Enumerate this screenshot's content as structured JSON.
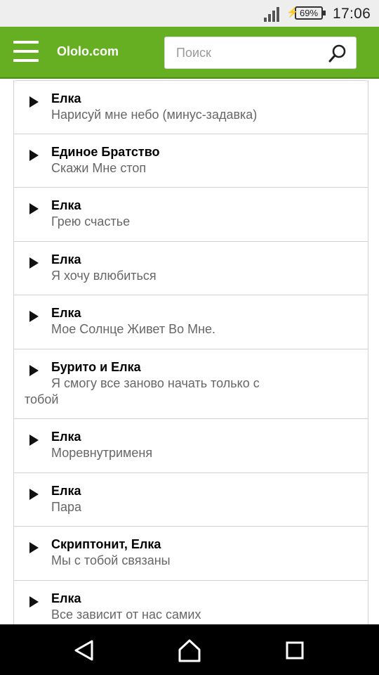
{
  "status": {
    "battery": "69%",
    "time": "17:06"
  },
  "header": {
    "brand": "Ololo.com",
    "search_placeholder": "Поиск",
    "accent": "#66ae22"
  },
  "tracks": [
    {
      "artist": "Елка",
      "title": "Нарисуй мне небо (минус-задавка)"
    },
    {
      "artist": "Единое Братство",
      "title": "Скажи Мне стоп"
    },
    {
      "artist": "Елка",
      "title": "Грею счастье"
    },
    {
      "artist": "Елка",
      "title": "Я хочу влюбиться"
    },
    {
      "artist": "Елка",
      "title": "Мое Солнце Живет Во Мне."
    },
    {
      "artist": "Бурито и Елка",
      "title": "Я смогу все заново начать только с тобой"
    },
    {
      "artist": "Елка",
      "title": "Моревнутрименя"
    },
    {
      "artist": "Елка",
      "title": "Пара"
    },
    {
      "artist": "Скриптонит, Елка",
      "title": "Мы с тобой связаны"
    },
    {
      "artist": "Елка",
      "title": "Все зависит от нас самих"
    }
  ],
  "icons": {
    "menu": "hamburger-menu-icon",
    "search": "search-icon",
    "play": "play-icon",
    "back": "back-triangle-icon",
    "home": "home-icon",
    "recents": "recents-square-icon"
  }
}
